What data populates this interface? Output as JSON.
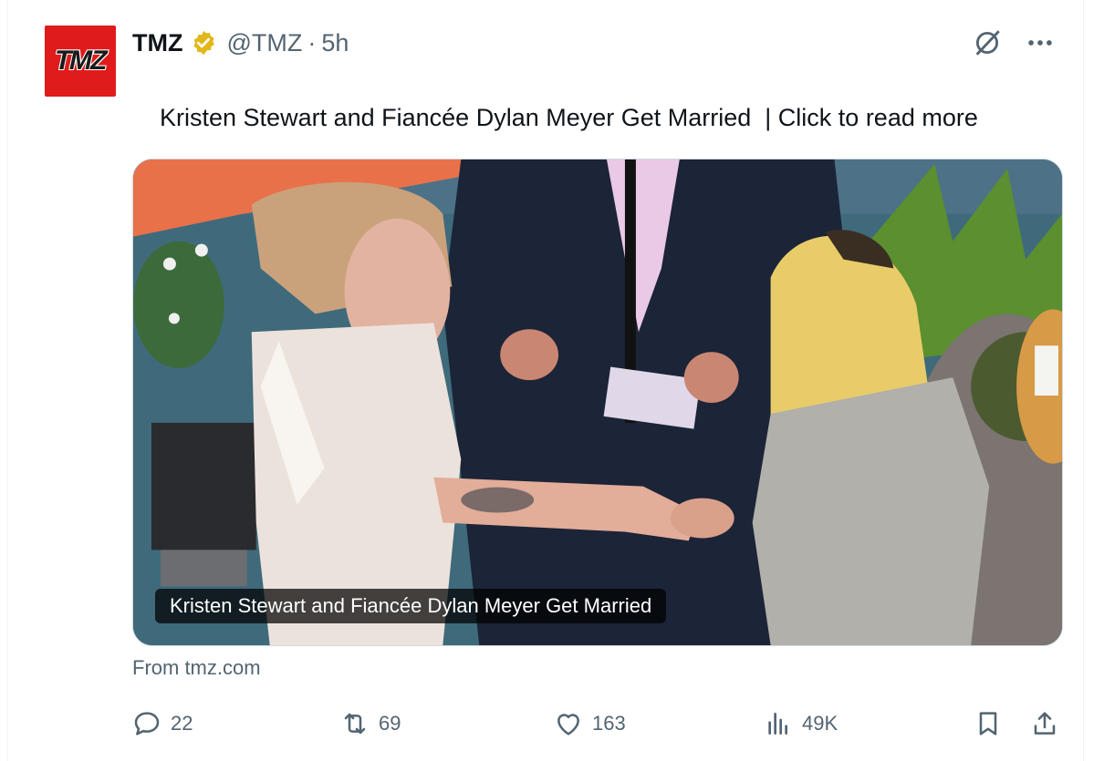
{
  "account": {
    "avatar_text": "TMZ",
    "name": "TMZ",
    "handle": "@TMZ",
    "separator": "·",
    "time": "5h"
  },
  "tweet": {
    "text": "Kristen Stewart and Fiancée Dylan Meyer Get Married  | Click to read more",
    "emoji": "👇"
  },
  "media": {
    "caption": "Kristen Stewart and Fiancée Dylan Meyer Get Married"
  },
  "source": "From tmz.com",
  "actions": {
    "replies": "22",
    "reposts": "69",
    "likes": "163",
    "views": "49K"
  },
  "icons": {
    "verified": "verified-badge-icon",
    "grok": "grok-icon",
    "more": "more-icon",
    "reply": "reply-icon",
    "repost": "repost-icon",
    "like": "heart-icon",
    "views": "views-icon",
    "bookmark": "bookmark-icon",
    "share": "share-icon"
  },
  "colors": {
    "text": "#0f1419",
    "muted": "#536471",
    "verified_gold": "#e2b719",
    "tmz_red": "#e01b1b"
  }
}
